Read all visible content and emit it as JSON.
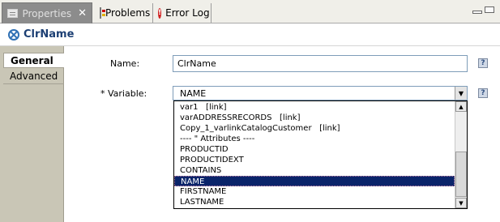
{
  "tabs": {
    "properties": "Properties",
    "problems": "Problems",
    "errorlog": "Error Log"
  },
  "header": {
    "title": "ClrName"
  },
  "sidebar": {
    "items": [
      {
        "label": "General"
      },
      {
        "label": "Advanced"
      }
    ]
  },
  "form": {
    "name_label": "Name:",
    "name_value": "ClrName",
    "variable_label": "* Variable:",
    "variable_value": "NAME",
    "help_glyph": "?"
  },
  "dropdown": {
    "options": [
      "var1   [link]",
      "varADDRESSRECORDS   [link]",
      "Copy_1_varlinkCatalogCustomer   [link]",
      "---- \" Attributes ----",
      "PRODUCTID",
      "PRODUCTIDEXT",
      "CONTAINS",
      "NAME",
      "FIRSTNAME",
      "LASTNAME"
    ],
    "selected_index": 7
  },
  "colors": {
    "selection": "#0a246a",
    "header_title": "#1c3f73",
    "sidebar_bg": "#c9c6b6"
  },
  "icons": {
    "properties_tab": "properties-icon",
    "problems_tab": "problems-icon",
    "errorlog_tab": "error-log-icon",
    "header": "close-circle-icon",
    "help": "help-icon"
  }
}
